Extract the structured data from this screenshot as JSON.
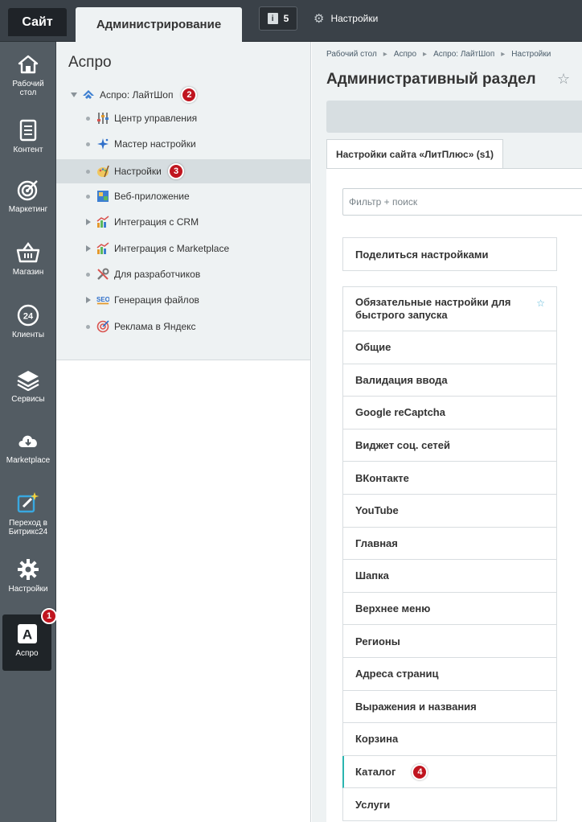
{
  "topbar": {
    "site_tab": "Сайт",
    "admin_tab": "Администрирование",
    "notifications_count": "5",
    "settings_label": "Настройки"
  },
  "leftnav": {
    "items": [
      {
        "label": "Рабочий стол",
        "icon": "home-icon"
      },
      {
        "label": "Контент",
        "icon": "document-icon"
      },
      {
        "label": "Маркетинг",
        "icon": "target-icon"
      },
      {
        "label": "Магазин",
        "icon": "basket-icon"
      },
      {
        "label": "Клиенты",
        "icon": "clients-24-icon",
        "icon_text": "24"
      },
      {
        "label": "Сервисы",
        "icon": "layers-icon"
      },
      {
        "label": "Marketplace",
        "icon": "cloud-download-icon"
      },
      {
        "label": "Переход в Битрикс24",
        "icon": "edit-sparkle-icon"
      },
      {
        "label": "Настройки",
        "icon": "gear-icon"
      },
      {
        "label": "Аспро",
        "icon": "aspro-a-icon",
        "icon_text": "A",
        "active": true,
        "badge": "1"
      }
    ]
  },
  "tree": {
    "title": "Аспро",
    "root": {
      "label": "Аспро: ЛайтШоп",
      "badge": "2"
    },
    "items": [
      {
        "label": "Центр управления",
        "marker": "dot",
        "icon": "sliders-icon"
      },
      {
        "label": "Мастер настройки",
        "marker": "dot",
        "icon": "sparkle-icon"
      },
      {
        "label": "Настройки",
        "marker": "dot",
        "icon": "palette-icon",
        "selected": true,
        "badge": "3"
      },
      {
        "label": "Веб-приложение",
        "marker": "dot",
        "icon": "web-app-icon"
      },
      {
        "label": "Интеграция с CRM",
        "marker": "arrow",
        "icon": "chart-icon"
      },
      {
        "label": "Интеграция с Marketplace",
        "marker": "arrow",
        "icon": "chart-icon"
      },
      {
        "label": "Для разработчиков",
        "marker": "dot",
        "icon": "tools-icon"
      },
      {
        "label": "Генерация файлов",
        "marker": "arrow",
        "icon": "seo-icon"
      },
      {
        "label": "Реклама в Яндекс",
        "marker": "dot",
        "icon": "target-ad-icon"
      }
    ]
  },
  "main": {
    "breadcrumbs": [
      "Рабочий стол",
      "Аспро",
      "Аспро: ЛайтШоп",
      "Настройки"
    ],
    "title": "Административный раздел",
    "site_tab": "Настройки сайта «ЛитПлюс» (s1)",
    "filter_placeholder": "Фильтр + поиск",
    "share_label": "Поделиться настройками",
    "sections": [
      "Обязательные настройки для быстрого запуска",
      "Общие",
      "Валидация ввода",
      "Google reCaptcha",
      "Виджет соц. сетей",
      "ВКонтакте",
      "YouTube",
      "Главная",
      "Шапка",
      "Верхнее меню",
      "Регионы",
      "Адреса страниц",
      "Выражения и названия",
      "Корзина",
      "Каталог",
      "Услуги"
    ],
    "active_section_index": 14,
    "active_section_badge": "4"
  },
  "colors": {
    "topbar": "#3a4148",
    "leftnav": "#535c63",
    "badge": "#c0151f",
    "active_accent": "#2bb5b0"
  }
}
